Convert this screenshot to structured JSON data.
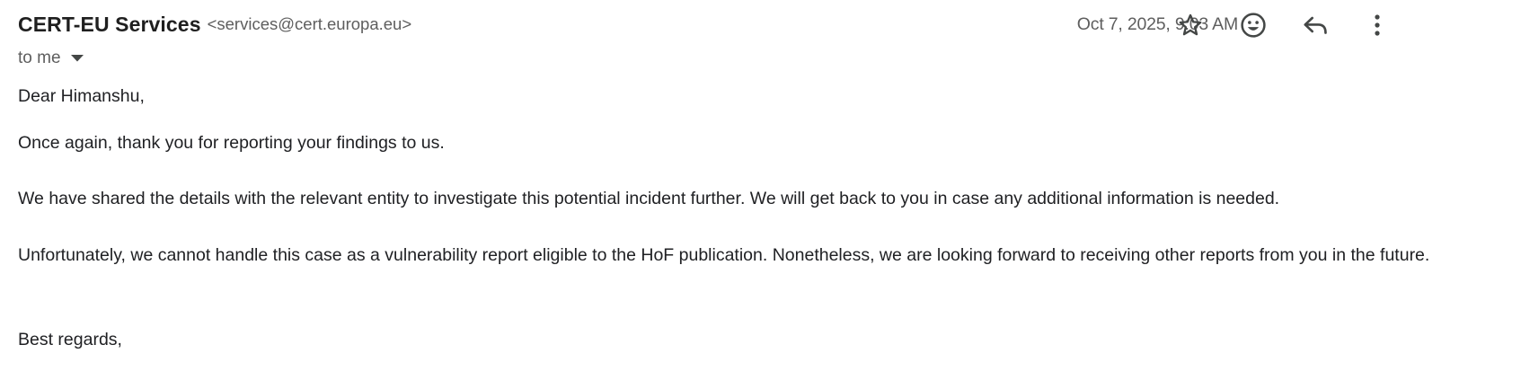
{
  "header": {
    "sender_name": "CERT-EU Services",
    "sender_email": "<services@cert.europa.eu>",
    "recipient_label": "to me",
    "timestamp": "Oct 7, 2025, 9:03 AM"
  },
  "actions": {
    "star_icon": "star-icon",
    "emoji_icon": "emoji-reaction-icon",
    "reply_icon": "reply-icon",
    "more_icon": "more-options-icon"
  },
  "message": {
    "greeting": "Dear Himanshu,",
    "paragraph_1": "Once again, thank you for reporting your findings to us.",
    "paragraph_2": "We have shared the details with the relevant entity to investigate this potential incident further. We will get back to you in case any additional information is needed.",
    "paragraph_3": "Unfortunately, we cannot handle this case as a vulnerability report eligible to the HoF publication. Nonetheless, we are looking forward to receiving other reports from you in the future.",
    "closing": "Best regards,"
  },
  "colors": {
    "text_primary": "#202124",
    "text_secondary": "#5e5e5e",
    "icon": "#444746"
  }
}
